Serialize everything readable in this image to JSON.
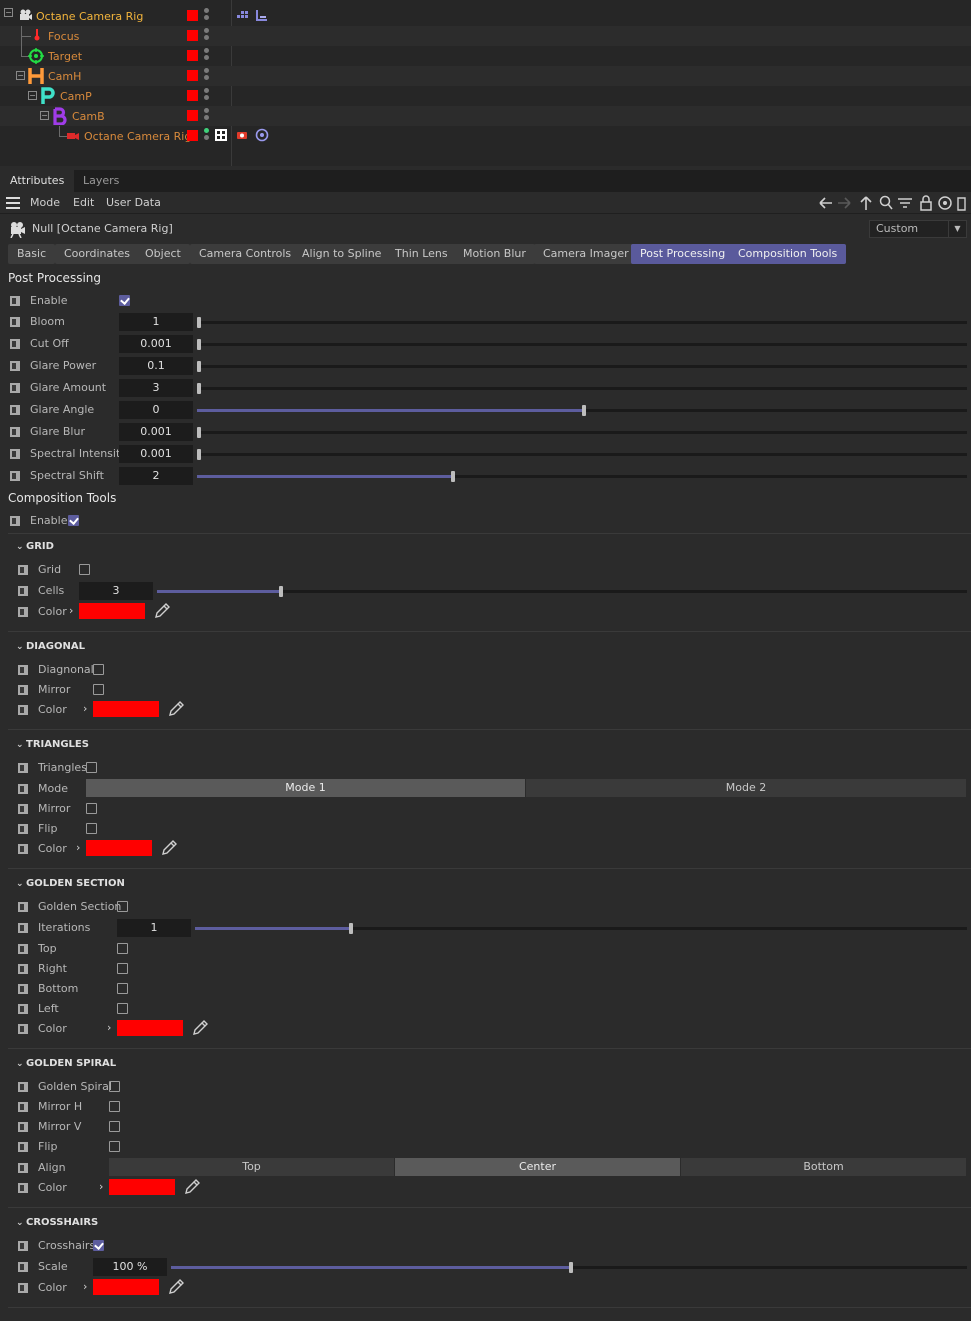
{
  "object_manager": {
    "rows": [
      {
        "name": "Octane Camera Rig",
        "selected": true
      },
      {
        "name": "Focus"
      },
      {
        "name": "Target"
      },
      {
        "name": "CamH"
      },
      {
        "name": "CamP"
      },
      {
        "name": "CamB"
      },
      {
        "name": "Octane Camera Rig"
      }
    ],
    "icons": {
      "root": "camera-rig-icon",
      "focus": "focus-pin-icon",
      "target": "target-icon",
      "camh": "letter-h-icon",
      "camp": "letter-p-icon",
      "camb": "letter-b-icon",
      "cam": "camera-icon"
    }
  },
  "panel_tabs": [
    "Attributes",
    "Layers"
  ],
  "menu": [
    "Mode",
    "Edit",
    "User Data"
  ],
  "object_title": "Null [Octane Camera Rig]",
  "layout_dropdown": "Custom",
  "property_tabs": [
    {
      "label": "Basic",
      "active": false
    },
    {
      "label": "Coordinates",
      "active": false
    },
    {
      "label": "Object",
      "active": false
    },
    {
      "label": "Camera Controls",
      "active": false
    },
    {
      "label": "Align to Spline",
      "active": false
    },
    {
      "label": "Thin Lens",
      "active": false
    },
    {
      "label": "Motion Blur",
      "active": false
    },
    {
      "label": "Camera Imager",
      "active": false
    },
    {
      "label": "Post Processing",
      "active": true
    },
    {
      "label": "Composition Tools",
      "active": true
    }
  ],
  "post_processing": {
    "title": "Post Processing",
    "enable_label": "Enable",
    "enable": true,
    "params": [
      {
        "label": "Bloom",
        "value": "1",
        "slider": 0.0
      },
      {
        "label": "Cut Off",
        "value": "0.001",
        "slider": 0.0
      },
      {
        "label": "Glare Power",
        "value": "0.1",
        "slider": 0.0
      },
      {
        "label": "Glare Amount",
        "value": "3",
        "slider": 0.0
      },
      {
        "label": "Glare Angle",
        "value": "0",
        "slider": 0.5
      },
      {
        "label": "Glare Blur",
        "value": "0.001",
        "slider": 0.0
      },
      {
        "label": "Spectral Intensity",
        "value": "0.001",
        "slider": 0.0
      },
      {
        "label": "Spectral Shift",
        "value": "2",
        "slider": 0.33
      }
    ]
  },
  "composition_tools": {
    "title": "Composition Tools",
    "enable_label": "Enable",
    "enable": true,
    "grid": {
      "title": "GRID",
      "grid_label": "Grid",
      "grid": false,
      "cells_label": "Cells",
      "cells": "3",
      "cells_slider": 0.15,
      "color_label": "Color"
    },
    "diagonal": {
      "title": "DIAGONAL",
      "diagonal_label": "Diagnonal",
      "diagonal": false,
      "mirror_label": "Mirror",
      "mirror": false,
      "color_label": "Color"
    },
    "triangles": {
      "title": "TRIANGLES",
      "triangles_label": "Triangles",
      "triangles": false,
      "mode_label": "Mode",
      "modes": [
        "Mode 1",
        "Mode 2"
      ],
      "mode_selected": "Mode 1",
      "mirror_label": "Mirror",
      "mirror": false,
      "flip_label": "Flip",
      "flip": false,
      "color_label": "Color"
    },
    "golden_section": {
      "title": "GOLDEN SECTION",
      "golden_label": "Golden Section",
      "golden": false,
      "iterations_label": "Iterations",
      "iterations": "1",
      "iterations_slider": 0.2,
      "top_label": "Top",
      "right_label": "Right",
      "bottom_label": "Bottom",
      "left_label": "Left",
      "color_label": "Color"
    },
    "golden_spiral": {
      "title": "GOLDEN SPIRAL",
      "spiral_label": "Golden Spiral",
      "spiral": false,
      "mirror_h_label": "Mirror H",
      "mirror_v_label": "Mirror V",
      "flip_label": "Flip",
      "align_label": "Align",
      "aligns": [
        "Top",
        "Center",
        "Bottom"
      ],
      "align_selected": "Center",
      "color_label": "Color"
    },
    "crosshairs": {
      "title": "CROSSHAIRS",
      "crosshairs_label": "Crosshairs",
      "crosshairs": true,
      "scale_label": "Scale",
      "scale": "100 %",
      "scale_slider": 0.5,
      "color_label": "Color"
    }
  },
  "colors": {
    "accent": "#5a5a9c",
    "swatch": "#ff0000",
    "selected_object": "#f2b43c",
    "object": "#d88a3c"
  }
}
